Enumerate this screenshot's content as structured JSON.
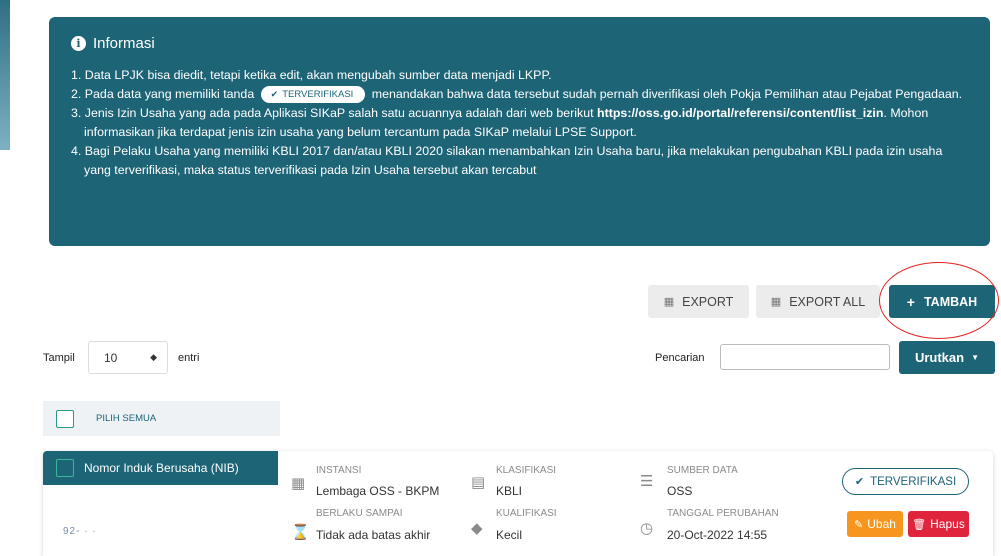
{
  "info": {
    "title": "Informasi",
    "item1": "1. Data LPJK bisa diedit, tetapi ketika edit, akan mengubah sumber data menjadi LKPP.",
    "item2_pre": "2. Pada data yang memiliki tanda",
    "item2_badge": "TERVERIFIKASI",
    "item2_post": "menandakan bahwa data tersebut sudah pernah diverifikasi oleh Pokja Pemilihan atau Pejabat Pengadaan.",
    "item3_pre": "3. Jenis Izin Usaha yang ada pada Aplikasi SIKaP salah satu acuannya adalah dari web berikut",
    "item3_link": "https://oss.go.id/portal/referensi/content/list_izin",
    "item3_post": ". Mohon informasikan jika terdapat jenis izin usaha yang belum tercantum pada SIKaP melalui LPSE Support.",
    "item4": "4. Bagi Pelaku Usaha yang memiliki KBLI 2017 dan/atau KBLI 2020 silakan menambahkan Izin Usaha baru, jika melakukan pengubahan KBLI pada izin usaha yang terverifikasi, maka status terverifikasi pada Izin Usaha tersebut akan tercabut"
  },
  "toolbar": {
    "export_label": "EXPORT",
    "export_all_label": "EXPORT ALL",
    "tambah_label": "TAMBAH"
  },
  "table_controls": {
    "tampil_label": "Tampil",
    "page_size": "10",
    "entri_label": "entri",
    "search_label": "Pencarian",
    "search_value": "",
    "sort_label": "Urutkan"
  },
  "select_all_label": "PILIH SEMUA",
  "record": {
    "tab_label": "Nomor Induk Berusaha (NIB)",
    "nib_value": "92-  ·  ·",
    "instansi_label": "INSTANSI",
    "instansi_value": "Lembaga OSS - BKPM",
    "klasifikasi_label": "KLASIFIKASI",
    "klasifikasi_value": "KBLI",
    "sumber_label": "SUMBER DATA",
    "sumber_value": "OSS",
    "berlaku_label": "BERLAKU SAMPAI",
    "berlaku_value": "Tidak ada batas akhir",
    "kualifikasi_label": "KUALIFIKASI",
    "kualifikasi_value": "Kecil",
    "tanggal_label": "TANGGAL PERUBAHAN",
    "tanggal_value": "20-Oct-2022 14:55",
    "status_badge": "TERVERIFIKASI",
    "ubah_label": "Ubah",
    "hapus_label": "Hapus"
  },
  "colors": {
    "primary": "#1d6477",
    "edit": "#f6961e",
    "delete": "#e0243c",
    "highlight_circle": "#e0241f"
  }
}
